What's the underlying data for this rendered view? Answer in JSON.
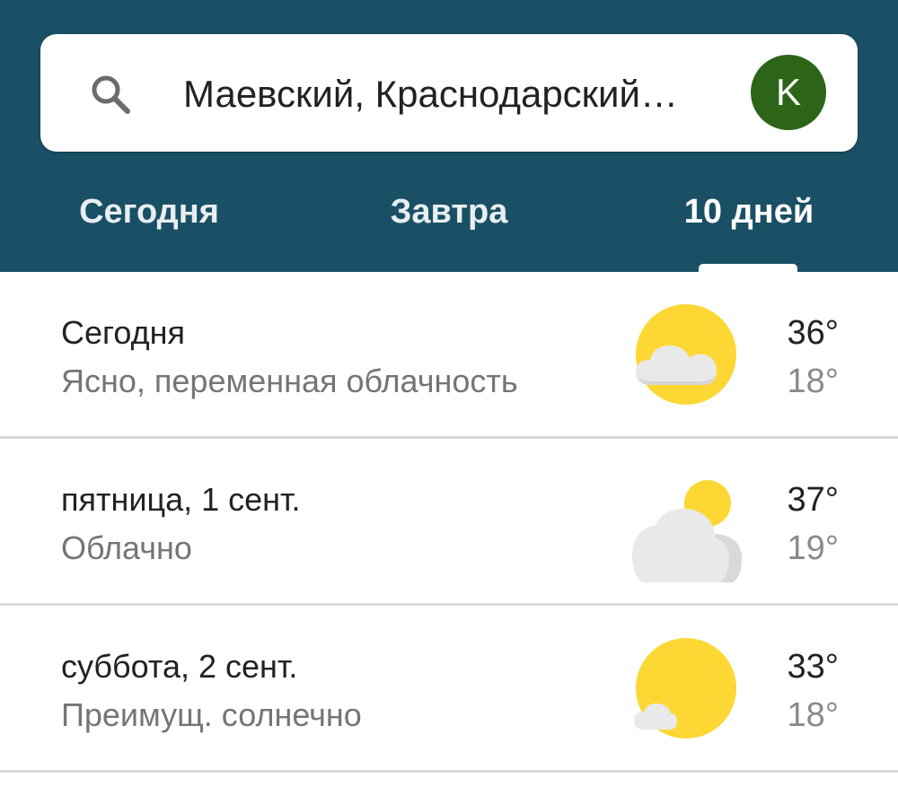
{
  "search": {
    "location": "Маевский, Краснодарский…",
    "avatar_letter": "K"
  },
  "tabs": [
    {
      "label": "Сегодня",
      "active": false
    },
    {
      "label": "Завтра",
      "active": false
    },
    {
      "label": "10 дней",
      "active": true
    }
  ],
  "forecast": [
    {
      "day": "Сегодня",
      "condition": "Ясно, переменная облачность",
      "high": "36°",
      "low": "18°",
      "icon": "partly-cloudy-icon"
    },
    {
      "day": "пятница, 1 сент.",
      "condition": "Облачно",
      "high": "37°",
      "low": "19°",
      "icon": "cloudy-icon"
    },
    {
      "day": "суббота, 2 сент.",
      "condition": "Преимущ. солнечно",
      "high": "33°",
      "low": "18°",
      "icon": "mostly-sunny-icon"
    }
  ],
  "colors": {
    "header": "#1a5066",
    "avatar": "#2c6418",
    "sun": "#fdd835",
    "cloud": "#eeeeee"
  }
}
